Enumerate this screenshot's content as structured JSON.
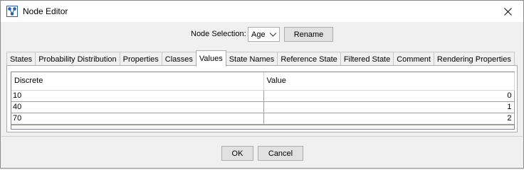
{
  "window": {
    "title": "Node Editor"
  },
  "node_selection": {
    "label": "Node Selection:",
    "selected_value": "Age",
    "rename_label": "Rename"
  },
  "tabs": [
    {
      "label": "States",
      "active": false
    },
    {
      "label": "Probability Distribution",
      "active": false
    },
    {
      "label": "Properties",
      "active": false
    },
    {
      "label": "Classes",
      "active": false
    },
    {
      "label": "Values",
      "active": true
    },
    {
      "label": "State Names",
      "active": false
    },
    {
      "label": "Reference State",
      "active": false
    },
    {
      "label": "Filtered State",
      "active": false
    },
    {
      "label": "Comment",
      "active": false
    },
    {
      "label": "Rendering Properties",
      "active": false
    }
  ],
  "table": {
    "columns": [
      "Discrete",
      "Value"
    ],
    "rows": [
      {
        "discrete": "10",
        "value": "0"
      },
      {
        "discrete": "40",
        "value": "1"
      },
      {
        "discrete": "70",
        "value": "2"
      }
    ]
  },
  "footer": {
    "ok_label": "OK",
    "cancel_label": "Cancel"
  }
}
